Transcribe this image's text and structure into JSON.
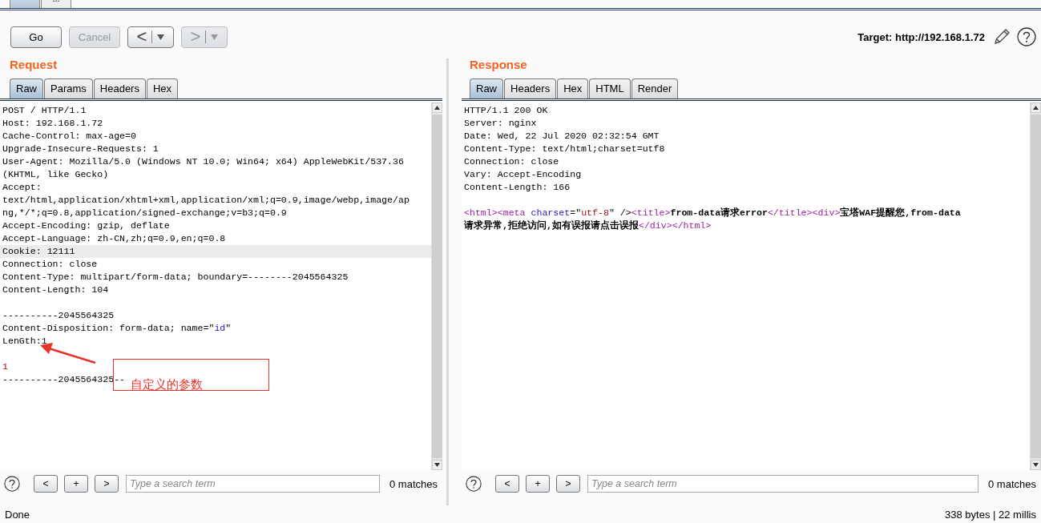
{
  "top_tabs": [
    {
      "selected": true
    },
    {
      "label": "...",
      "selected": false
    }
  ],
  "toolbar": {
    "buttons": [
      {
        "label": "Go",
        "disabled": false,
        "kind": "text"
      },
      {
        "label": "Cancel",
        "disabled": true,
        "kind": "text"
      },
      {
        "label": "<",
        "disabled": false,
        "kind": "history"
      },
      {
        "label": ">",
        "disabled": true,
        "kind": "history"
      }
    ],
    "target": "Target: http://192.168.1.72"
  },
  "request": {
    "title": "Request",
    "tabs": [
      {
        "label": "Raw",
        "selected": true
      },
      {
        "label": "Params",
        "selected": false
      },
      {
        "label": "Headers",
        "selected": false
      },
      {
        "label": "Hex",
        "selected": false
      }
    ],
    "lines": [
      {
        "selected": false,
        "segments": [
          {
            "kind": "plain",
            "text": "POST / HTTP/1.1"
          }
        ]
      },
      {
        "selected": false,
        "segments": [
          {
            "kind": "plain",
            "text": "Host: 192.168.1.72"
          }
        ]
      },
      {
        "selected": false,
        "segments": [
          {
            "kind": "plain",
            "text": "Cache-Control: max-age=0"
          }
        ]
      },
      {
        "selected": false,
        "segments": [
          {
            "kind": "plain",
            "text": "Upgrade-Insecure-Requests: 1"
          }
        ]
      },
      {
        "selected": false,
        "segments": [
          {
            "kind": "plain",
            "text": "User-Agent: Mozilla/5.0 (Windows NT 10.0; Win64; x64) AppleWebKit/537.36"
          }
        ]
      },
      {
        "selected": false,
        "segments": [
          {
            "kind": "plain",
            "text": "(KHTML, like Gecko)"
          }
        ]
      },
      {
        "selected": false,
        "segments": [
          {
            "kind": "plain",
            "text": "Accept:"
          }
        ]
      },
      {
        "selected": false,
        "segments": [
          {
            "kind": "plain",
            "text": "text/html,application/xhtml+xml,application/xml;q=0.9,image/webp,image/ap"
          }
        ]
      },
      {
        "selected": false,
        "segments": [
          {
            "kind": "plain",
            "text": "ng,*/*;q=0.8,application/signed-exchange;v=b3;q=0.9"
          }
        ]
      },
      {
        "selected": false,
        "segments": [
          {
            "kind": "plain",
            "text": "Accept-Encoding: gzip, deflate"
          }
        ]
      },
      {
        "selected": false,
        "segments": [
          {
            "kind": "plain",
            "text": "Accept-Language: zh-CN,zh;q=0.9,en;q=0.8"
          }
        ]
      },
      {
        "selected": true,
        "segments": [
          {
            "kind": "plain",
            "text": "Cookie: 12111"
          }
        ]
      },
      {
        "selected": false,
        "segments": [
          {
            "kind": "plain",
            "text": "Connection: close"
          }
        ]
      },
      {
        "selected": false,
        "segments": [
          {
            "kind": "plain",
            "text": "Content-Type: multipart/form-data; boundary=--------2045564325"
          }
        ]
      },
      {
        "selected": false,
        "segments": [
          {
            "kind": "plain",
            "text": "Content-Length: 104"
          }
        ]
      },
      {
        "selected": false
      },
      {
        "selected": false,
        "segments": [
          {
            "kind": "plain",
            "text": "----------2045564325"
          }
        ]
      },
      {
        "selected": false,
        "segments": [
          {
            "kind": "plain",
            "text": "Content-Disposition: form-data; name=\""
          },
          {
            "kind": "attr",
            "text": "id"
          },
          {
            "kind": "plain",
            "text": "\""
          }
        ]
      },
      {
        "selected": false,
        "segments": [
          {
            "kind": "plain",
            "text": "LenGth:1"
          }
        ]
      },
      {
        "selected": false
      },
      {
        "selected": false,
        "segments": [
          {
            "kind": "value",
            "text": "1"
          }
        ]
      },
      {
        "selected": false,
        "segments": [
          {
            "kind": "plain",
            "text": "----------2045564325--"
          }
        ]
      }
    ],
    "annotation": "自定义的参数",
    "search": {
      "nav_buttons": [
        "<",
        "+",
        ">"
      ],
      "placeholder": "Type a search term",
      "matches": "0 matches"
    }
  },
  "response": {
    "title": "Response",
    "tabs": [
      {
        "label": "Raw",
        "selected": true
      },
      {
        "label": "Headers",
        "selected": false
      },
      {
        "label": "Hex",
        "selected": false
      },
      {
        "label": "HTML",
        "selected": false
      },
      {
        "label": "Render",
        "selected": false
      }
    ],
    "lines": [
      {
        "selected": false,
        "segments": [
          {
            "kind": "plain",
            "text": "HTTP/1.1 200 OK"
          }
        ]
      },
      {
        "selected": false,
        "segments": [
          {
            "kind": "plain",
            "text": "Server: nginx"
          }
        ]
      },
      {
        "selected": false,
        "segments": [
          {
            "kind": "plain",
            "text": "Date: Wed, 22 Jul 2020 02:32:54 GMT"
          }
        ]
      },
      {
        "selected": false,
        "segments": [
          {
            "kind": "plain",
            "text": "Content-Type: text/html;charset=utf8"
          }
        ]
      },
      {
        "selected": false,
        "segments": [
          {
            "kind": "plain",
            "text": "Connection: close"
          }
        ]
      },
      {
        "selected": false,
        "segments": [
          {
            "kind": "plain",
            "text": "Vary: Accept-Encoding"
          }
        ]
      },
      {
        "selected": false,
        "segments": [
          {
            "kind": "plain",
            "text": "Content-Length: 166"
          }
        ]
      },
      {
        "selected": false
      },
      {
        "selected": false,
        "segments": [
          {
            "kind": "tag",
            "text": "<html>"
          },
          {
            "kind": "tag",
            "text": "<meta "
          },
          {
            "kind": "attr",
            "text": "charset"
          },
          {
            "kind": "plain",
            "text": "=\""
          },
          {
            "kind": "value",
            "text": "utf-8"
          },
          {
            "kind": "plain",
            "text": "\" />"
          },
          {
            "kind": "tag",
            "text": "<title>"
          },
          {
            "kind": "bold",
            "text": "from-data请求error"
          },
          {
            "kind": "tag",
            "text": "</title>"
          },
          {
            "kind": "tag",
            "text": "<div>"
          },
          {
            "kind": "bold",
            "text": "宝塔WAF提醒您,from-data"
          }
        ]
      },
      {
        "selected": false,
        "segments": [
          {
            "kind": "bold",
            "text": "请求异常,拒绝访问,如有误报请点击误报"
          },
          {
            "kind": "tag",
            "text": "</div>"
          },
          {
            "kind": "tag",
            "text": "</html>"
          }
        ]
      }
    ],
    "search": {
      "nav_buttons": [
        "<",
        "+",
        ">"
      ],
      "placeholder": "Type a search term",
      "matches": "0 matches"
    }
  },
  "status_bar": {
    "left": "Done",
    "right": "338 bytes | 22 millis"
  }
}
